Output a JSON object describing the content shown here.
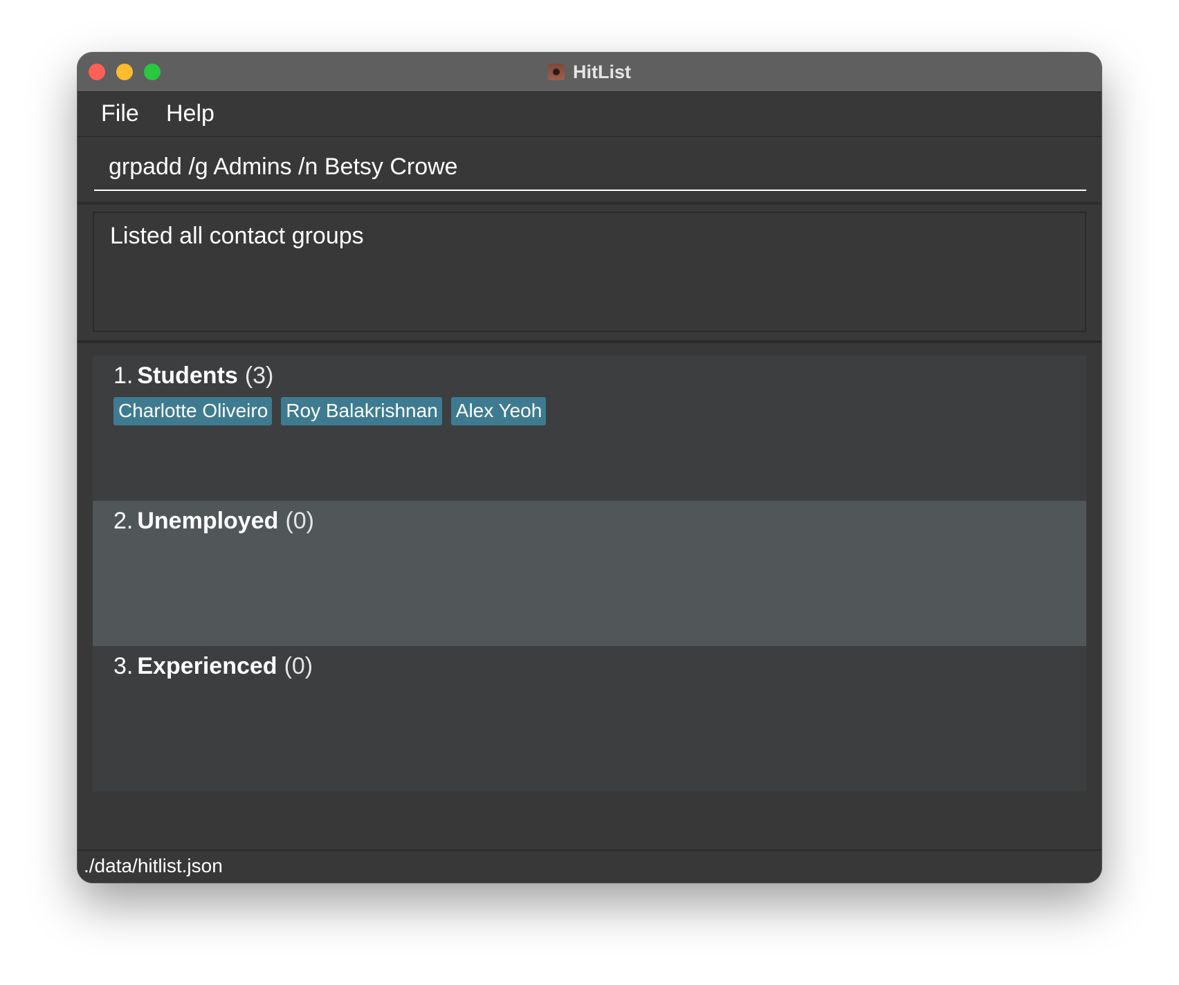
{
  "window": {
    "title": "HitList",
    "icon": "hitlist-app-icon"
  },
  "menu": {
    "file": "File",
    "help": "Help"
  },
  "command": {
    "value": "grpadd /g Admins /n Betsy Crowe"
  },
  "result": {
    "message": "Listed all contact groups"
  },
  "groups": [
    {
      "index": "1.",
      "name": "Students",
      "count": "(3)",
      "members": [
        "Charlotte Oliveiro",
        "Roy Balakrishnan",
        "Alex Yeoh"
      ]
    },
    {
      "index": "2.",
      "name": "Unemployed",
      "count": "(0)",
      "members": [],
      "selected": true
    },
    {
      "index": "3.",
      "name": "Experienced",
      "count": "(0)",
      "members": []
    }
  ],
  "status": {
    "file_path": "./data/hitlist.json"
  },
  "colors": {
    "background": "#383838",
    "titlebar": "#5f5f5f",
    "tag": "#3e7b91",
    "selected_row": "#515659",
    "card": "#3c3e3f"
  }
}
